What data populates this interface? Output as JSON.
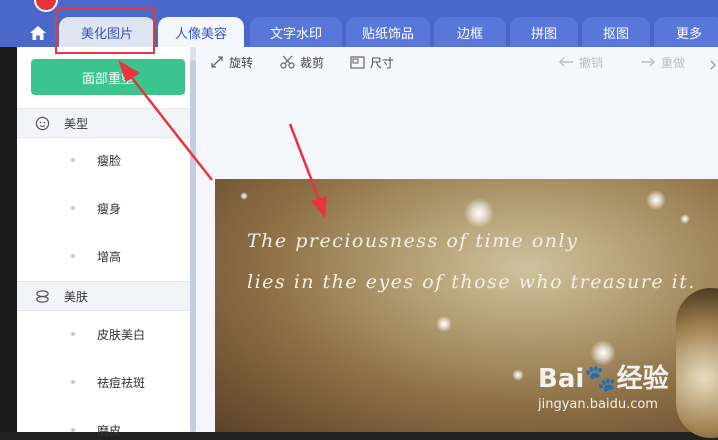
{
  "tabs": {
    "home_icon": "home-icon",
    "items": [
      {
        "label": "美化图片",
        "state": "first"
      },
      {
        "label": "人像美容",
        "state": "active"
      },
      {
        "label": "文字水印",
        "state": "inactive"
      },
      {
        "label": "贴纸饰品",
        "state": "inactive"
      },
      {
        "label": "边框",
        "state": "inactive"
      },
      {
        "label": "拼图",
        "state": "inactive"
      },
      {
        "label": "抠图",
        "state": "inactive"
      },
      {
        "label": "更多",
        "state": "inactive"
      }
    ]
  },
  "left_panel": {
    "face_button": "面部重塑",
    "sections": [
      {
        "label": "美型",
        "icon": "face-icon",
        "items": [
          "瘦脸",
          "瘦身",
          "增高"
        ]
      },
      {
        "label": "美肤",
        "icon": "skin-icon",
        "items": [
          "皮肤美白",
          "祛痘祛斑",
          "磨皮"
        ]
      }
    ]
  },
  "toolbar": {
    "rotate": "旋转",
    "crop": "裁剪",
    "size": "尺寸",
    "undo": "撤销",
    "redo": "重做"
  },
  "photo": {
    "quote_line1": "The preciousness of time only",
    "quote_line2": "lies in the eyes of those who treasure it."
  },
  "watermark": {
    "main": "Bai🐾经验",
    "sub": "jingyan.baidu.com"
  },
  "colors": {
    "tab_bar": "#4a68c9",
    "accent_green": "#3bc48e",
    "highlight_red": "#e33a3a"
  }
}
